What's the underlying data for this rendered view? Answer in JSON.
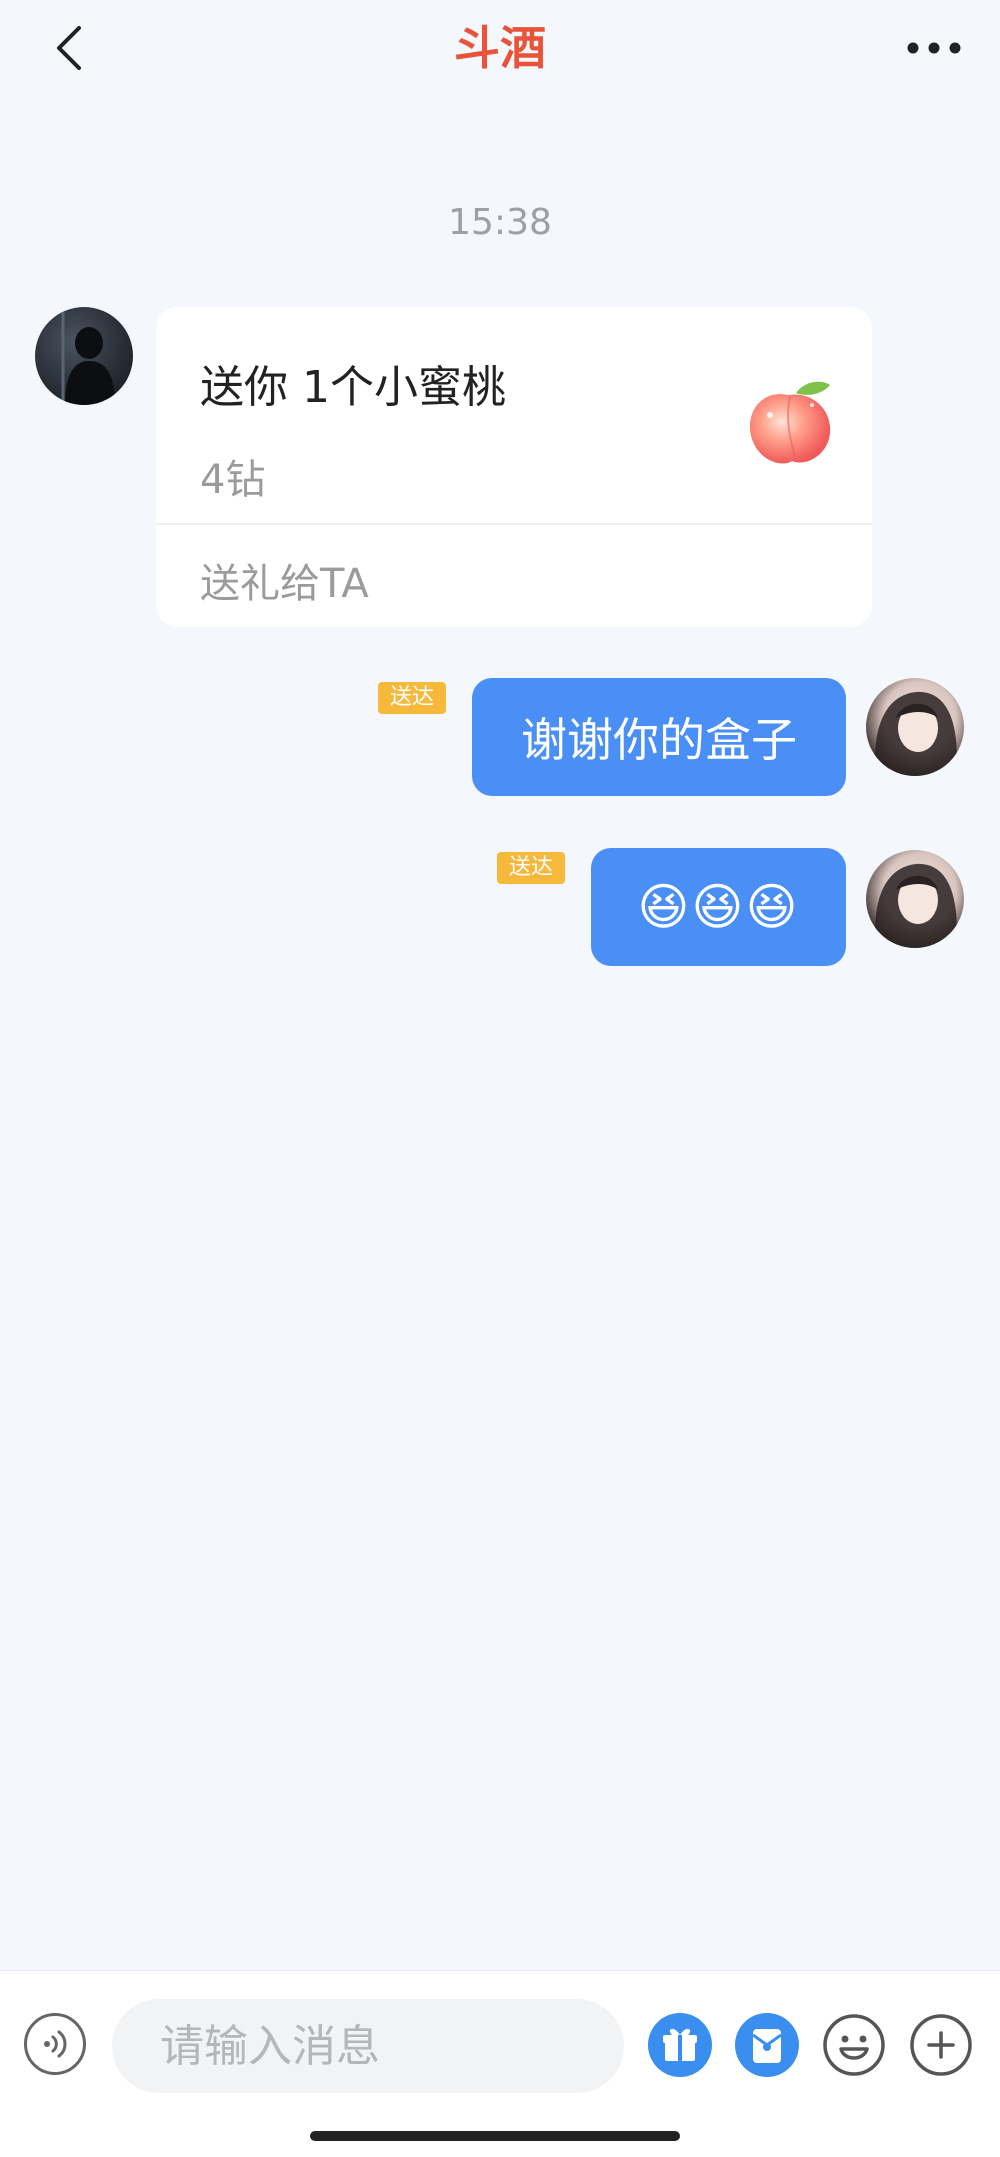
{
  "header": {
    "title": "斗酒"
  },
  "chat": {
    "timestamp": "15:38",
    "gift_card": {
      "title": "送你 1个小蜜桃",
      "price": "4钻",
      "action": "送礼给TA",
      "icon": "peach-icon"
    },
    "messages": [
      {
        "status": "送达",
        "text": "谢谢你的盒子"
      },
      {
        "status": "送达",
        "text": "😆😆😆"
      }
    ]
  },
  "input_bar": {
    "placeholder": "请输入消息",
    "icons": [
      "voice-icon",
      "gift-icon",
      "red-packet-icon",
      "emoji-icon",
      "plus-icon"
    ]
  },
  "colors": {
    "title": "#e8533a",
    "bubble": "#4a8ff5",
    "badge": "#f6b93b",
    "background": "#f4f7fb",
    "icon_blue": "#3a8ef0"
  }
}
